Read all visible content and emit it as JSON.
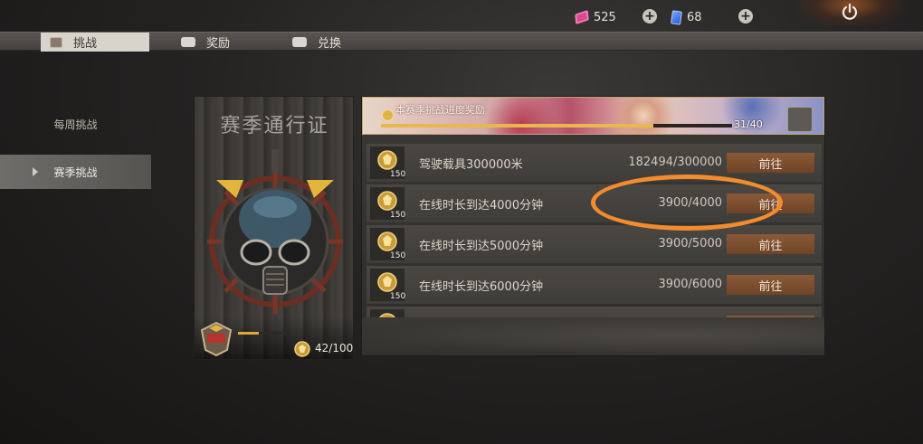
{
  "currency": {
    "ticket_icon": "ticket-icon",
    "ticket_amount": "525",
    "card_icon": "card-icon",
    "card_amount": "68",
    "add_icon": "plus-circle-icon",
    "power_icon": "power-icon"
  },
  "tabs": [
    {
      "label": "挑战",
      "icon": "challenge-icon",
      "active": true
    },
    {
      "label": "奖励",
      "icon": "reward-box-icon",
      "active": false
    },
    {
      "label": "兑换",
      "icon": "exchange-box-icon",
      "active": false
    }
  ],
  "sidebar": [
    {
      "label": "每周挑战",
      "active": false
    },
    {
      "label": "赛季挑战",
      "active": true
    }
  ],
  "pass_card": {
    "title": "赛季通行证",
    "emblem_icon": "gas-mask-emblem-icon",
    "level_badge_icon": "level-badge-icon",
    "progress_fraction": 0.42,
    "coin_icon": "coin-icon",
    "count": "42/100"
  },
  "banner": {
    "label": "本赛季挑战进度奖励",
    "progress": "31/40",
    "progress_fraction": 0.775,
    "chest_icon": "reward-chest-icon"
  },
  "challenges": [
    {
      "title": "驾驶载具300000米",
      "progress": "182494/300000",
      "reward": "150",
      "button": "前往"
    },
    {
      "title": "在线时长到达4000分钟",
      "progress": "3900/4000",
      "reward": "150",
      "button": "前往"
    },
    {
      "title": "在线时长到达5000分钟",
      "progress": "3900/5000",
      "reward": "150",
      "button": "前往"
    },
    {
      "title": "在线时长到达6000分钟",
      "progress": "3900/6000",
      "reward": "150",
      "button": "前往"
    },
    {
      "title": "",
      "progress": "",
      "reward": "",
      "button": ""
    }
  ],
  "colors": {
    "accent_gold": "#e0a63a",
    "button_brown": "#7a4c2e",
    "annotation_orange": "#f28c2e"
  }
}
